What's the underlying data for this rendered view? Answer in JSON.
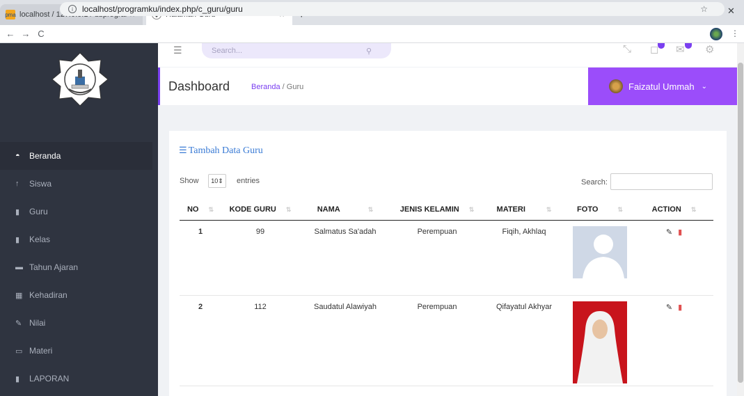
{
  "browser": {
    "tabs": [
      {
        "title": "localhost / 127.0.0.1 / dbprogram",
        "active": false
      },
      {
        "title": "Halaman Guru",
        "active": true
      }
    ],
    "url": "localhost/programku/index.php/c_guru/guru"
  },
  "topbar": {
    "search_placeholder": "Search..."
  },
  "sidebar": {
    "items": [
      {
        "label": "Beranda",
        "icon": "dashboard-icon",
        "active": true
      },
      {
        "label": "Siswa",
        "icon": "student-icon"
      },
      {
        "label": "Guru",
        "icon": "teacher-icon"
      },
      {
        "label": "Kelas",
        "icon": "class-icon"
      },
      {
        "label": "Tahun Ajaran",
        "icon": "folder-icon"
      },
      {
        "label": "Kehadiran",
        "icon": "calendar-icon"
      },
      {
        "label": "Nilai",
        "icon": "pencil-icon"
      },
      {
        "label": "Materi",
        "icon": "book-icon"
      },
      {
        "label": "LAPORAN",
        "icon": "file-icon"
      }
    ]
  },
  "header": {
    "title": "Dashboard",
    "breadcrumb_link": "Beranda",
    "breadcrumb_sep": "/",
    "breadcrumb_current": "Guru",
    "user_name": "Faizatul Ummah"
  },
  "card": {
    "title": "Tambah Data Guru",
    "show_label": "Show",
    "entries_value": "10",
    "entries_label": "entries",
    "search_label": "Search:"
  },
  "table": {
    "columns": [
      "NO",
      "KODE GURU",
      "NAMA",
      "JENIS KELAMIN",
      "MATERI",
      "FOTO",
      "ACTION"
    ],
    "rows": [
      {
        "no": "1",
        "kode": "99",
        "nama": "Salmatus Sa'adah",
        "jk": "Perempuan",
        "materi": "Fiqih, Akhlaq",
        "foto": "placeholder-avatar"
      },
      {
        "no": "2",
        "kode": "112",
        "nama": "Saudatul Alawiyah",
        "jk": "Perempuan",
        "materi": "Qifayatul Akhyar",
        "foto": "hijab-portrait"
      }
    ]
  },
  "colors": {
    "sidebar": "#2f3440",
    "accent": "#9b4dfa",
    "link": "#3a7bd5"
  }
}
